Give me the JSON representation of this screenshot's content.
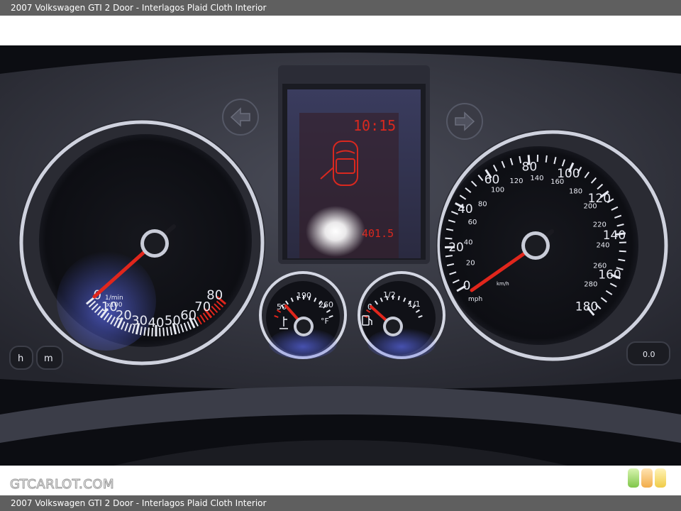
{
  "caption": {
    "top": "2007 Volkswagen GTI 2 Door - Interlagos Plaid Cloth Interior",
    "bottom": "2007 Volkswagen GTI 2 Door - Interlagos Plaid Cloth Interior"
  },
  "watermark": "GTCARLOT.COM",
  "tachometer": {
    "labels": [
      "0",
      "10",
      "20",
      "30",
      "40",
      "50",
      "60",
      "70",
      "80"
    ],
    "unit_line1": "1/min",
    "unit_line2": "x100"
  },
  "speedometer": {
    "mph_labels": [
      "0",
      "20",
      "40",
      "60",
      "80",
      "100",
      "120",
      "140",
      "160",
      "180"
    ],
    "kmh_labels": [
      "20",
      "40",
      "60",
      "80",
      "100",
      "120",
      "140",
      "160",
      "180",
      "200",
      "220",
      "240",
      "260",
      "280"
    ],
    "unit_mph": "mph",
    "unit_kmh": "km/h"
  },
  "coolant_gauge": {
    "labels": [
      "50",
      "190",
      "260"
    ],
    "unit": "°F"
  },
  "fuel_gauge": {
    "labels": [
      "0",
      "1/2",
      "1/1"
    ]
  },
  "display": {
    "clock": "10:15",
    "odometer": "401.5"
  },
  "buttons": {
    "hour": "h",
    "minute": "m",
    "trip_reset": "0.0"
  },
  "icons": [
    "left-turn-signal-icon",
    "right-turn-signal-icon",
    "door-open-car-icon",
    "coolant-thermometer-icon",
    "fuel-pump-icon"
  ],
  "colors": {
    "needle": "#e0261c",
    "dial_ring": "#c9ccd8",
    "display_red": "#d9281f"
  }
}
